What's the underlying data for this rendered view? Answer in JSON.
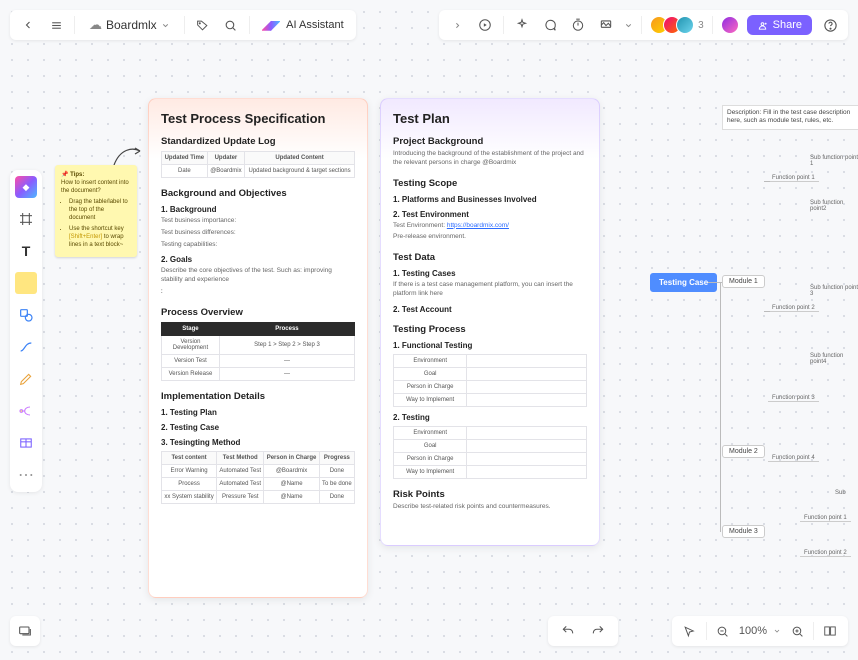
{
  "topbar": {
    "brand": "Boardmlx",
    "ai_label": "AI Assistant",
    "share_label": "Share",
    "user_count": "3"
  },
  "sticky": {
    "title": "📌 Tips:",
    "intro": "How to insert content into the document?",
    "b1": "Drag the table/label to the top of the document",
    "b2a": "Use the shortcut key ",
    "b2key": "[Shift+Enter]",
    "b2b": " to wrap lines in a text block~"
  },
  "spec": {
    "title": "Test Process Specification",
    "h_update": "Standardized Update Log",
    "t1": [
      "Updated Time",
      "Updater",
      "Updated Content"
    ],
    "r1": [
      "Date",
      "@Boardmix",
      "Updated background & target sections"
    ],
    "h_bg": "Background and Objectives",
    "h_bg1": "1. Background",
    "bg1": "Test business importance:",
    "bg2": "Test business differences:",
    "bg3": "Testing capabilities:",
    "h_goals": "2. Goals",
    "goals": "Describe the core objectives of the test. Such as: improving stability and experience",
    "h_overview": "Process Overview",
    "ov_head": [
      "Stage",
      "Process"
    ],
    "ov_r1": [
      "Version Development",
      "Step 1 > Step 2 > Step 3"
    ],
    "ov_r2": [
      "Version Test",
      "—"
    ],
    "ov_r3": [
      "Version Release",
      "—"
    ],
    "h_impl": "Implementation Details",
    "impl1": "1. Testing Plan",
    "impl2": "2. Testing Case",
    "impl3": "3. Tesingting Method",
    "m_head": [
      "Test content",
      "Test Method",
      "Person in Charge",
      "Progress"
    ],
    "m_r1": [
      "Error Warning",
      "Automated Test",
      "@Boardmix",
      "Done"
    ],
    "m_r2": [
      "Process",
      "Automated Test",
      "@Name",
      "To be done"
    ],
    "m_r3": [
      "xx System stability",
      "Pressure Test",
      "@Name",
      "Done"
    ]
  },
  "plan": {
    "title": "Test Plan",
    "h_proj": "Project Background",
    "proj_txt": "Introducing the background of the establishment of the project and the relevant persons in charge @Boardmix",
    "h_scope": "Testing Scope",
    "scope1": "1. Platforms and Businesses Involved",
    "scope2": "2. Test Environment",
    "env_label": "Test Environment: ",
    "env_link": "https://boardmix.com/",
    "env_note": "Pre-release environment.",
    "h_data": "Test Data",
    "data1": "1. Testing Cases",
    "data1_txt": "If there is a test case management platform, you can insert the platform link here",
    "data2": "2. Test Account",
    "h_proc": "Testing Process",
    "proc1": "1. Functional Testing",
    "ft_rows": [
      "Environment",
      "Goal",
      "Person in Charge",
      "Way to Implement"
    ],
    "proc2": "2. Testing",
    "t2_rows": [
      "Environment",
      "Goal",
      "Person in Charge",
      "Way to Implement"
    ],
    "h_risk": "Risk Points",
    "risk_txt": "Describe test-related risk points and countermeasures."
  },
  "mindmap": {
    "desc": "Description: Fill in the test case description here, such as module test, rules, etc.",
    "root": "Testing Case",
    "mod1": "Module 1",
    "mod2": "Module 2",
    "mod3": "Module 3",
    "sf1": "Sub function point 1",
    "fp1": "Function point 1",
    "sf2": "Sub function point2",
    "sf3": "Sub function point 3",
    "fp2": "Function point 2",
    "sf4": "Sub function point4",
    "fp3": "Function point 3",
    "fp4": "Function point 4",
    "sub": "Sub",
    "fpB1": "Function point 1",
    "fpB2": "Function point 2"
  },
  "bottombar": {
    "zoom": "100%"
  }
}
